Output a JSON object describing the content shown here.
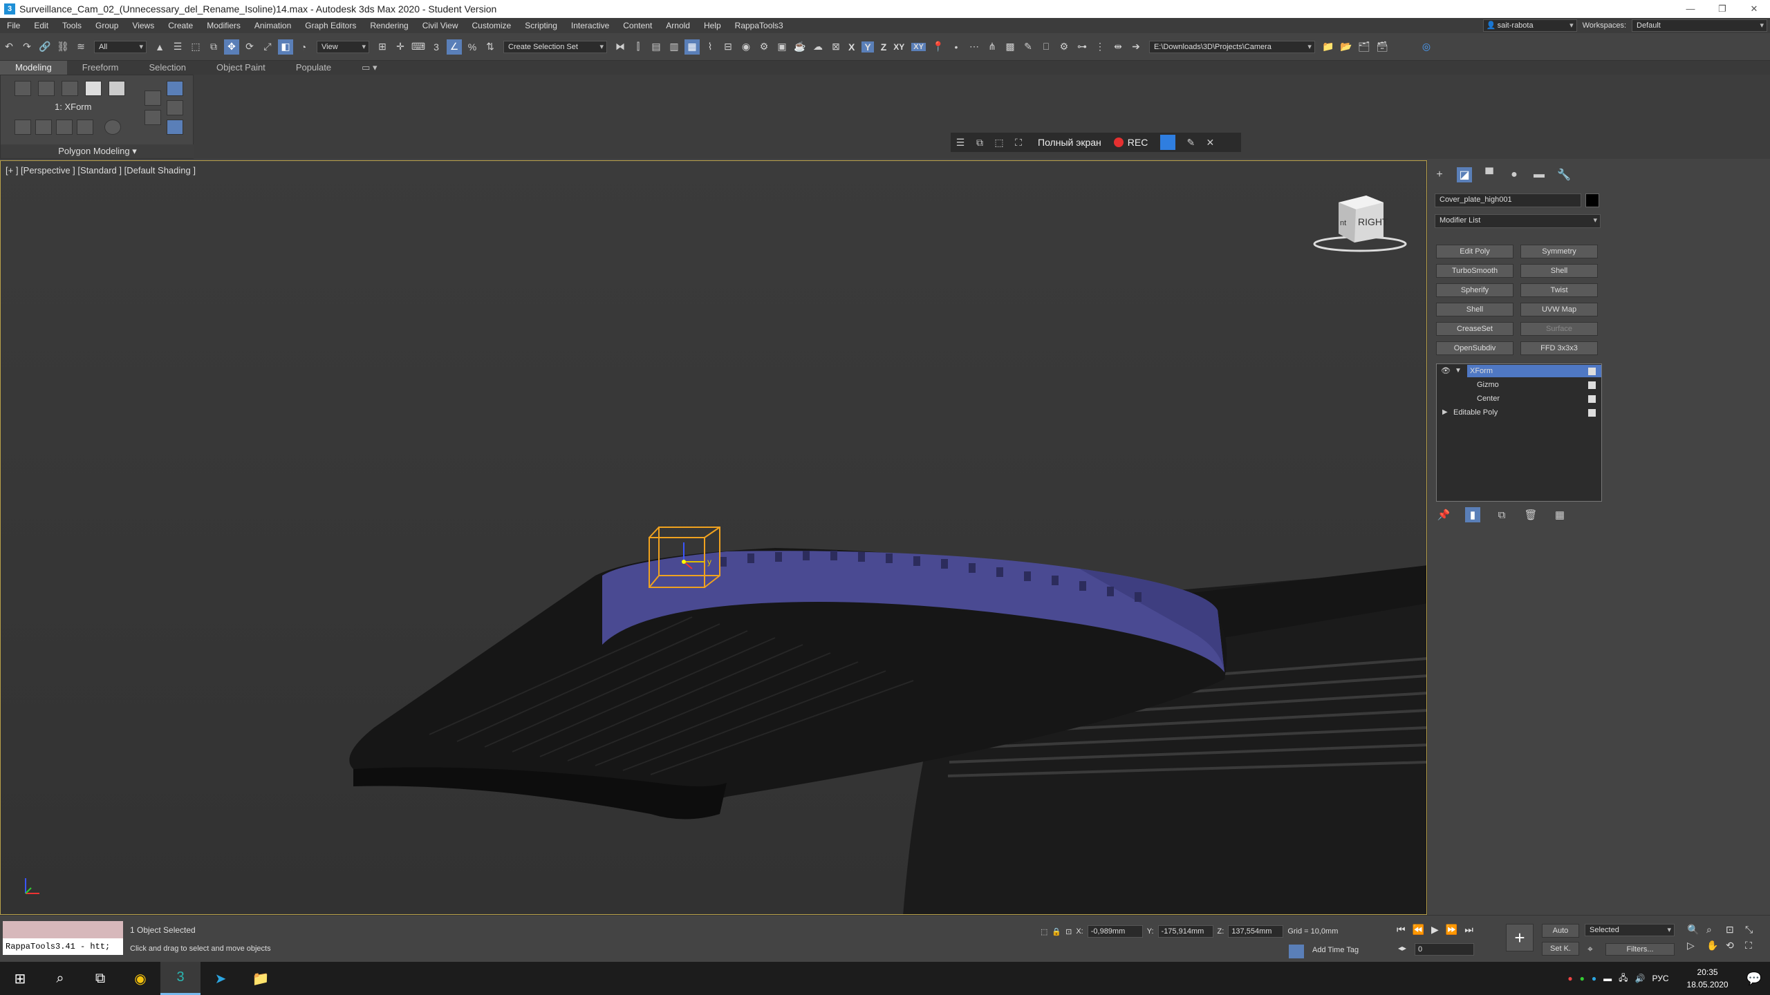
{
  "window": {
    "title": "Surveillance_Cam_02_(Unnecessary_del_Rename_Isoline)14.max - Autodesk 3ds Max 2020 - Student Version"
  },
  "menu": {
    "items": [
      "File",
      "Edit",
      "Tools",
      "Group",
      "Views",
      "Create",
      "Modifiers",
      "Animation",
      "Graph Editors",
      "Rendering",
      "Civil View",
      "Customize",
      "Scripting",
      "Interactive",
      "Content",
      "Arnold",
      "Help",
      "RappaTools3"
    ],
    "user": "sait-rabota",
    "workspaces_label": "Workspaces:",
    "workspace": "Default"
  },
  "toolbar": {
    "filter": "All",
    "view": "View",
    "selection_set": "Create Selection Set",
    "axis_x": "X",
    "axis_y": "Y",
    "axis_z": "Z",
    "axis_xy": "XY",
    "axis_xy2": "XY",
    "project_path": "E:\\Downloads\\3D\\Projects\\Camera"
  },
  "ribbon": {
    "tabs": [
      "Modeling",
      "Freeform",
      "Selection",
      "Object Paint",
      "Populate"
    ],
    "active_tab": "Modeling",
    "modifier_label": "1: XForm",
    "panel_label": "Polygon Modeling"
  },
  "recorder": {
    "fullscreen": "Полный экран",
    "rec": "REC"
  },
  "viewport": {
    "label": "[+ ] [Perspective ] [Standard ] [Default Shading ]",
    "viewcube_face": "RIGHT",
    "viewcube_side": "nt",
    "gizmo_axis": "y"
  },
  "command_panel": {
    "object_name": "Cover_plate_high001",
    "modifier_list": "Modifier List",
    "modifier_buttons": [
      {
        "label": "Edit Poly",
        "enabled": true
      },
      {
        "label": "Symmetry",
        "enabled": true
      },
      {
        "label": "TurboSmooth",
        "enabled": true
      },
      {
        "label": "Shell",
        "enabled": true
      },
      {
        "label": "Spherify",
        "enabled": true
      },
      {
        "label": "Twist",
        "enabled": true
      },
      {
        "label": "Shell",
        "enabled": true
      },
      {
        "label": "UVW Map",
        "enabled": true
      },
      {
        "label": "CreaseSet",
        "enabled": true
      },
      {
        "label": "Surface",
        "enabled": false
      },
      {
        "label": "OpenSubdiv",
        "enabled": true
      },
      {
        "label": "FFD 3x3x3",
        "enabled": true
      }
    ],
    "stack": [
      {
        "label": "XForm",
        "level": 0,
        "selected": true,
        "expanded": true
      },
      {
        "label": "Gizmo",
        "level": 1,
        "selected": false
      },
      {
        "label": "Center",
        "level": 1,
        "selected": false
      },
      {
        "label": "Editable Poly",
        "level": 0,
        "selected": false,
        "expanded": false
      }
    ]
  },
  "status": {
    "maxscript": "RappaTools3.41 - htt;",
    "selected": "1 Object Selected",
    "prompt": "Click and drag to select and move objects",
    "x_label": "X:",
    "x": "-0,989mm",
    "y_label": "Y:",
    "y": "-175,914mm",
    "z_label": "Z:",
    "z": "137,554mm",
    "grid": "Grid = 10,0mm",
    "add_time_tag": "Add Time Tag",
    "frame": "0",
    "auto": "Auto",
    "setk": "Set K.",
    "selected_combo": "Selected",
    "filters": "Filters..."
  },
  "taskbar": {
    "lang": "РУС",
    "time": "20:35",
    "date": "18.05.2020"
  }
}
